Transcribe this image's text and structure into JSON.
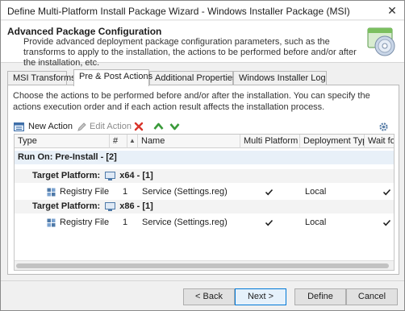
{
  "window": {
    "title": "Define Multi-Platform Install Package Wizard - Windows Installer Package (MSI)",
    "close_glyph": "✕"
  },
  "header": {
    "title": "Advanced Package Configuration",
    "description": "Provide advanced deployment package configuration parameters, such as the transforms to apply to the installation, the actions to be performed before and/or after the installation, etc."
  },
  "tabs": [
    {
      "label": "MSI Transforms"
    },
    {
      "label": "Pre & Post Actions"
    },
    {
      "label": "Additional Properties"
    },
    {
      "label": "Windows Installer Log"
    }
  ],
  "panel": {
    "description": "Choose the actions to be performed before and/or after the installation. You can specify the actions execution order and if each action result affects the installation process."
  },
  "toolbar": {
    "new_action": "New Action",
    "edit_action": "Edit Action",
    "icons": [
      "new-action-icon",
      "edit-action-icon",
      "delete-icon",
      "move-up-icon",
      "move-down-icon",
      "settings-icon"
    ]
  },
  "grid": {
    "columns": [
      "Type",
      "#",
      "Name",
      "Multi Platform",
      "Deployment Type",
      "Wait for C"
    ],
    "sort_glyph": "▲",
    "group": "Run On: Pre-Install - [2]",
    "subgroups": [
      {
        "label": "Target Platform:",
        "platform": "x64 - [1]",
        "row": {
          "type": "Registry File",
          "num": "1",
          "name": "Service (Settings.reg)",
          "multi_platform": true,
          "deployment_type": "Local",
          "wait": true
        }
      },
      {
        "label": "Target Platform:",
        "platform": "x86 - [1]",
        "row": {
          "type": "Registry File",
          "num": "1",
          "name": "Service (Settings.reg)",
          "multi_platform": true,
          "deployment_type": "Local",
          "wait": true
        }
      }
    ]
  },
  "buttons": {
    "back": "< Back",
    "next": "Next >",
    "define": "Define",
    "cancel": "Cancel"
  },
  "colors": {
    "accent": "#0078d7",
    "group_bg": "#e8f0f8",
    "add_green": "#3a9a3a",
    "delete_red": "#d9342b"
  }
}
